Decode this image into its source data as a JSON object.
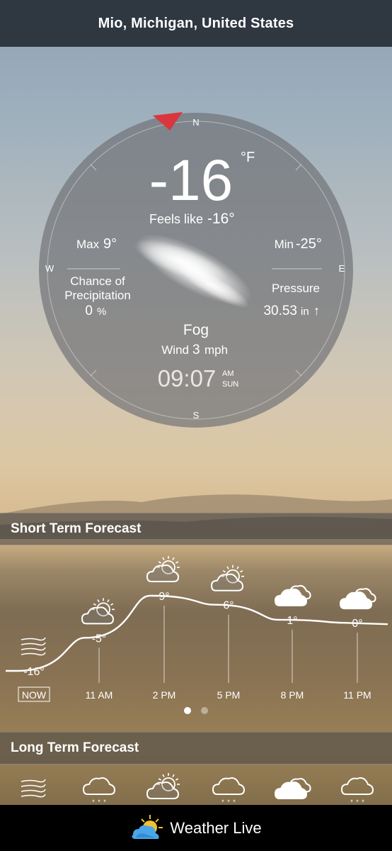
{
  "location": "Mio, Michigan, United States",
  "current": {
    "temperature": "-16",
    "unit": "°F",
    "feels_like_label": "Feels like",
    "feels_like_value": "-16°",
    "max_label": "Max",
    "max_value": "9°",
    "min_label": "Min",
    "min_value": "-25°",
    "precip_label_line1": "Chance of",
    "precip_label_line2": "Precipitation",
    "precip_value": "0",
    "precip_unit": "%",
    "pressure_label": "Pressure",
    "pressure_value": "30.53",
    "pressure_unit": "in",
    "pressure_trend": "↑",
    "condition": "Fog",
    "wind_label": "Wind",
    "wind_value": "3",
    "wind_unit": "mph",
    "time": "09:07",
    "ampm": "AM",
    "day": "SUN"
  },
  "compass": {
    "n": "N",
    "s": "S",
    "e": "E",
    "w": "W"
  },
  "short_term": {
    "title": "Short Term Forecast",
    "points": [
      {
        "time": "NOW",
        "temp": "-16°",
        "value": -16,
        "icon": "wind-icon"
      },
      {
        "time": "11 AM",
        "temp": "-5°",
        "value": -5,
        "icon": "partly-cloudy-icon"
      },
      {
        "time": "2 PM",
        "temp": "9°",
        "value": 9,
        "icon": "partly-cloudy-icon"
      },
      {
        "time": "5 PM",
        "temp": "6°",
        "value": 6,
        "icon": "partly-cloudy-icon"
      },
      {
        "time": "8 PM",
        "temp": "1°",
        "value": 1,
        "icon": "cloudy-icon"
      },
      {
        "time": "11 PM",
        "temp": "0°",
        "value": 0,
        "icon": "cloudy-icon"
      }
    ]
  },
  "long_term": {
    "title": "Long Term Forecast",
    "icons": [
      "wind-icon",
      "snow-icon",
      "partly-cloudy-icon",
      "snow-icon",
      "cloudy-icon",
      "snow-icon"
    ]
  },
  "brand": "Weather Live",
  "colors": {
    "accent": "#d9373f",
    "topbar": "#2f3741"
  }
}
